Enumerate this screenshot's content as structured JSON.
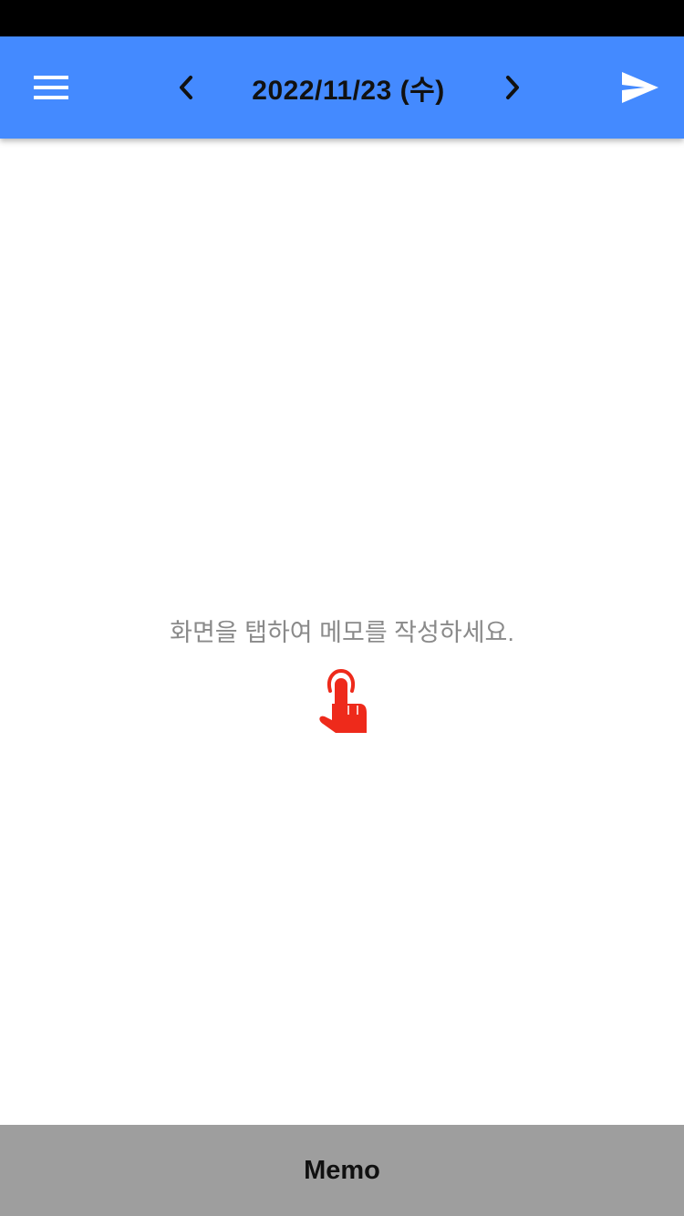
{
  "header": {
    "date_title": "2022/11/23 (수)",
    "background_color": "#448aff",
    "icons": {
      "menu": "menu-icon",
      "previous": "chevron-left-icon",
      "next": "chevron-right-icon",
      "send": "send-icon"
    }
  },
  "main": {
    "hint": "화면을 탭하여 메모를 작성하세요.",
    "hint_icon": "tap-hand-icon",
    "hint_icon_color": "#ee2a1b"
  },
  "bottom_bar": {
    "label": "Memo",
    "background_color": "#9e9e9e"
  }
}
